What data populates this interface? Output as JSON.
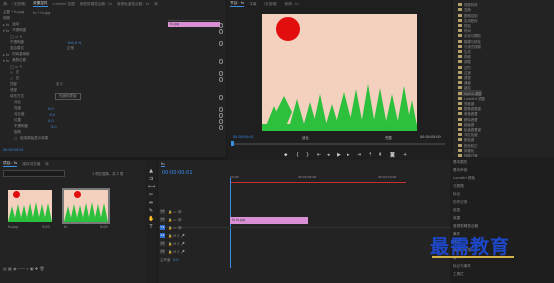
{
  "effect_controls": {
    "tabs": [
      "源：（无剪辑）",
      "效果控件",
      "Lumetri 范围",
      "音频剪辑混合器：fu",
      "音频轨道混合器：fu",
      "库"
    ],
    "source_line": "主要 * fu.jpg",
    "clip_line": "fu * fu.jpg",
    "section_video": "视频",
    "items": [
      {
        "label": "运动",
        "value": ""
      },
      {
        "label": "不透明度",
        "value": ""
      },
      {
        "label": "不透明度",
        "value": "100.0 %"
      },
      {
        "label": "混合模式",
        "value": "正常"
      },
      {
        "label": "时间重映射",
        "value": ""
      },
      {
        "label": "裁剪位移",
        "value": ""
      },
      {
        "label": "左",
        "value": ""
      },
      {
        "label": "右",
        "value": ""
      },
      {
        "label": "顶部",
        "value": ""
      },
      {
        "label": "底部",
        "value": ""
      },
      {
        "label": "填充类型",
        "value": "定义"
      },
      {
        "label": "颜色",
        "value": ""
      },
      {
        "label": "填充方式",
        "value": "亮度和蒙版"
      },
      {
        "label": "对比",
        "value": ""
      },
      {
        "label": "亮度",
        "value": "0.0"
      },
      {
        "label": "对比度",
        "value": "0.0"
      },
      {
        "label": "位置",
        "value": "0.0"
      },
      {
        "label": "不透明度",
        "value": "0.0"
      },
      {
        "label": "旋转",
        "value": ""
      }
    ],
    "check_label": "使用原始显示效果",
    "mini_timeline_clip": "fu.jpg",
    "timecode": "00:00:00:01"
  },
  "program_monitor": {
    "tabs": [
      "节目：fu",
      "字幕",
      "（无剪辑）",
      "音频：fu"
    ],
    "timecode_left": "00:00:00:01",
    "fit": "适合",
    "quality": "完整",
    "timecode_right": "00:00:05:00",
    "sun_color": "#e20d0d",
    "bg_color": "#f4d1bf",
    "tree_color": "#2cc03c"
  },
  "effects_panel": {
    "items": [
      "视频特效",
      "变换",
      "图像控制",
      "实用程序",
      "扭曲",
      "时间",
      "杂色与颗粒",
      "模糊与锐化",
      "沉浸式视频",
      "生成",
      "视频",
      "调整",
      "过时",
      "过渡",
      "透视",
      "通道",
      "键控",
      "Alpha 调整",
      "Lumetri 调整",
      "亮度键",
      "图像遮罩键",
      "差值遮罩",
      "移除遮罩",
      "超级键",
      "轨道遮罩键",
      "非红色键",
      "颜色键",
      "颜色校正",
      "风格化",
      "视频过渡"
    ]
  },
  "project_panel": {
    "tabs": [
      "项目：fu",
      "媒体浏览器",
      "库"
    ],
    "search_placeholder": "",
    "items_label": "1 项已选择，共 2 项",
    "clips": [
      {
        "name": "fu.jpg",
        "duration": "5:00"
      },
      {
        "name": "fu",
        "duration": "5:00"
      }
    ]
  },
  "timeline": {
    "tab": "fu",
    "timecode": "00:00:00:01",
    "ruler": [
      "00:00",
      "00:00:05:00",
      "00:00:10:00"
    ],
    "tracks": [
      "V3",
      "V2",
      "V1",
      "A1",
      "A2",
      "A3"
    ],
    "master": "主声道",
    "master_value": "0.0",
    "clip_label": "fx fu.jpg"
  },
  "right_panel": {
    "items": [
      "基本图形",
      "基本声音",
      "Lumetri 颜色",
      "元数据",
      "标记",
      "历史记录",
      "信息",
      "效果",
      "音频剪辑混合器",
      "事件",
      "捕捉",
      "编辑到磁带",
      "库",
      "标记与事件",
      "工具栏"
    ]
  },
  "watermark": "最需教育"
}
